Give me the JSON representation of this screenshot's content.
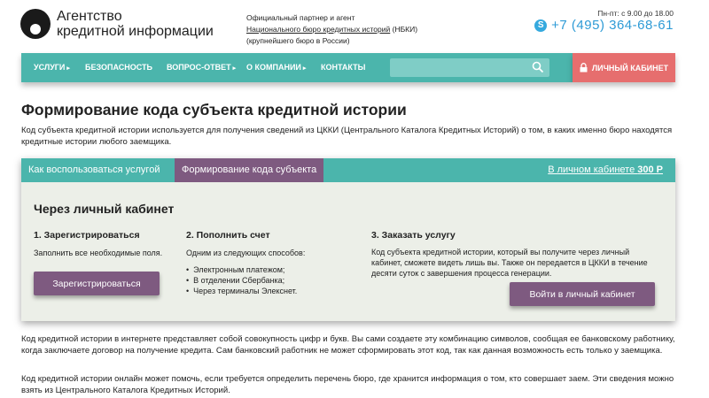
{
  "header": {
    "logo_line1": "Агентство",
    "logo_line2": "кредитной информации",
    "partner_line1": "Официальный партнер и агент",
    "partner_link": "Национального бюро кредитных историй",
    "partner_suffix": " (НБКИ)",
    "partner_line3": "(крупнейшего бюро в России)",
    "hours": "Пн-пт: с 9.00 до 18.00",
    "phone": "+7 (495) 364-68-61"
  },
  "nav": {
    "items": [
      {
        "label": "Услуги",
        "caret": "▸"
      },
      {
        "label": "Безопасность",
        "caret": ""
      },
      {
        "label": "Вопрос-ответ",
        "caret": "▸"
      },
      {
        "label": "О компании",
        "caret": "▸"
      },
      {
        "label": "Контакты",
        "caret": ""
      }
    ],
    "search_placeholder": "",
    "cabinet_label": "Личный кабинет"
  },
  "page": {
    "title": "Формирование кода субъекта кредитной истории",
    "intro": "Код субъекта кредитной истории используется для получения сведений из ЦККИ (Центрального Каталога Кредитных Историй) о том, в каких именно бюро находятся кредитные истории любого заемщика."
  },
  "card": {
    "tabs": [
      {
        "label": "Как воспользоваться услугой",
        "active": false
      },
      {
        "label": "Формирование кода субъекта",
        "active": true
      }
    ],
    "cabinet_link_text": "В личном кабинете ",
    "cabinet_link_price": "300 Р",
    "title": "Через личный кабинет",
    "step1": {
      "heading": "1. Зарегистрироваться",
      "text": "Заполнить все необходимые поля.",
      "button": "Зарегистрироваться"
    },
    "step2": {
      "heading": "2. Пополнить счет",
      "text": "Одним из следующих способов:",
      "items": [
        "Электронным платежом;",
        "В отделении Сбербанка;",
        "Через терминалы Элекснет."
      ]
    },
    "step3": {
      "heading": "3. Заказать услугу",
      "text": "Код субъекта кредитной истории, который вы получите через личный кабинет, сможете видеть лишь вы. Также он передается в ЦККИ в течение десяти суток с завершения процесса генерации.",
      "button": "Войти в личный кабинет"
    }
  },
  "paragraphs": [
    "Код кредитной истории в интернете представляет собой совокупность цифр и букв. Вы сами создаете эту комбинацию символов, сообщая ее банковскому работнику, когда заключаете договор на получение кредита. Сам банковский работник не может сформировать этот код, так как данная возможность есть только у заемщика.",
    "Код кредитной истории онлайн может помочь, если требуется определить перечень бюро, где хранится информация о том, кто совершает заем. Эти сведения можно взять из Центрального Каталога Кредитных Историй."
  ],
  "colors": {
    "teal": "#4bb5ac",
    "purple": "#7e5a80",
    "red": "#e66e6e",
    "phone_blue": "#2e9bd6"
  }
}
